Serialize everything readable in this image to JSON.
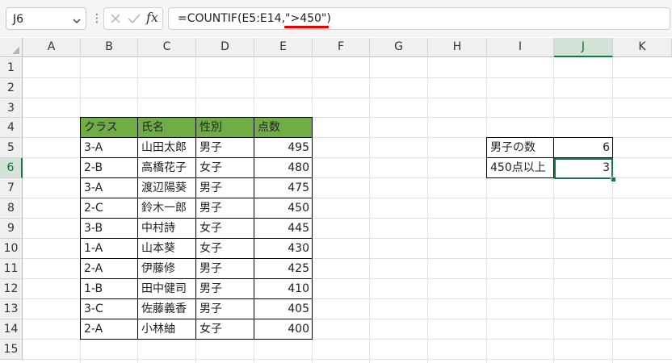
{
  "formula_bar": {
    "name_box": "J6",
    "more_dots": "⋮",
    "fx_label": "fx",
    "formula": "=COUNTIF(E5:E14,\">450\")"
  },
  "columns": [
    "A",
    "B",
    "C",
    "D",
    "E",
    "F",
    "G",
    "H",
    "I",
    "J",
    "K"
  ],
  "rows": [
    "1",
    "2",
    "3",
    "4",
    "5",
    "6",
    "7",
    "8",
    "9",
    "10",
    "11",
    "12",
    "13",
    "14",
    "15"
  ],
  "selected_cell": "J6",
  "table": {
    "header_color": "#70ad47",
    "headers": [
      "クラス",
      "氏名",
      "性別",
      "点数"
    ],
    "records": [
      [
        "3-A",
        "山田太郎",
        "男子",
        "495"
      ],
      [
        "2-B",
        "高橋花子",
        "女子",
        "480"
      ],
      [
        "3-A",
        "渡辺陽葵",
        "男子",
        "475"
      ],
      [
        "2-C",
        "鈴木一郎",
        "男子",
        "450"
      ],
      [
        "3-B",
        "中村詩",
        "女子",
        "445"
      ],
      [
        "1-A",
        "山本葵",
        "女子",
        "430"
      ],
      [
        "2-A",
        "伊藤修",
        "男子",
        "425"
      ],
      [
        "1-B",
        "田中健司",
        "男子",
        "410"
      ],
      [
        "3-C",
        "佐藤義香",
        "男子",
        "405"
      ],
      [
        "2-A",
        "小林紬",
        "女子",
        "400"
      ]
    ]
  },
  "summary": [
    {
      "label": "男子の数",
      "value": "6"
    },
    {
      "label": "450点以上",
      "value": "3"
    }
  ],
  "accent_color": "#107c41",
  "annotation_color": "#e60000"
}
